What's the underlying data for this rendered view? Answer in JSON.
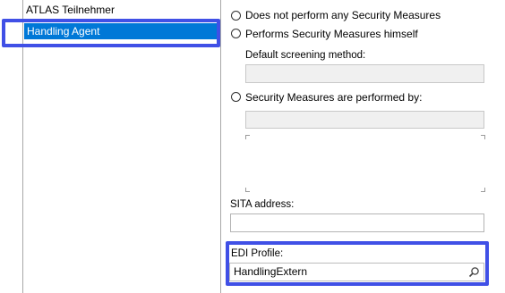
{
  "list": {
    "items": [
      {
        "label": "ATLAS Teilnehmer"
      },
      {
        "label": "Handling Agent"
      }
    ]
  },
  "security": {
    "option_none": "Does not perform any Security Measures",
    "option_self": "Performs Security Measures himself",
    "screening_label": "Default screening method:",
    "screening_value": "",
    "option_by": "Security Measures are performed by:",
    "performed_by_value": ""
  },
  "sita": {
    "label": "SITA address:",
    "value": ""
  },
  "edi": {
    "label": "EDI Profile:",
    "value": "HandlingExtern"
  },
  "colors": {
    "selection": "#0078d7",
    "highlight": "#4050e6"
  },
  "icons": {
    "search": "search-icon"
  }
}
